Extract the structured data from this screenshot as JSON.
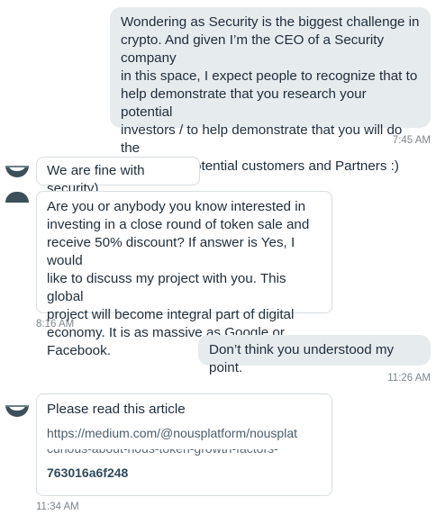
{
  "messages": [
    {
      "direction": "outgoing",
      "lines": [
        "Wondering as Security is the biggest challenge in",
        "crypto. And given I’m the CEO of a Security company",
        "in this space, I expect people to recognize that to",
        "help demonstrate that you research your potential",
        "investors / to help demonstrate that you will do the",
        "same with potential customers and Partners :)"
      ],
      "time": "7:45 AM"
    },
    {
      "direction": "incoming",
      "lines": [
        "We are fine with security)"
      ]
    },
    {
      "direction": "incoming",
      "lines": [
        "Are you or anybody you know interested in",
        "investing in a close round of token sale and",
        "receive 50% discount? If answer is Yes, I would",
        "like to discuss my project with you. This global",
        "project will become integral part of digital",
        "economy. It is as massive as Google or Facebook."
      ],
      "time": "8:16 AM"
    },
    {
      "direction": "outgoing",
      "lines": [
        "Don’t think you understood my point."
      ],
      "time": "11:26 AM"
    },
    {
      "direction": "incoming",
      "intro": "Please read this article",
      "link_partial_top": "https://medium.com/@nousplatform/nousplat",
      "link_partial_bottom": "curious-about-nous-token-growth-factors-",
      "link_end": "763016a6f248",
      "time": "11:34 AM"
    }
  ]
}
